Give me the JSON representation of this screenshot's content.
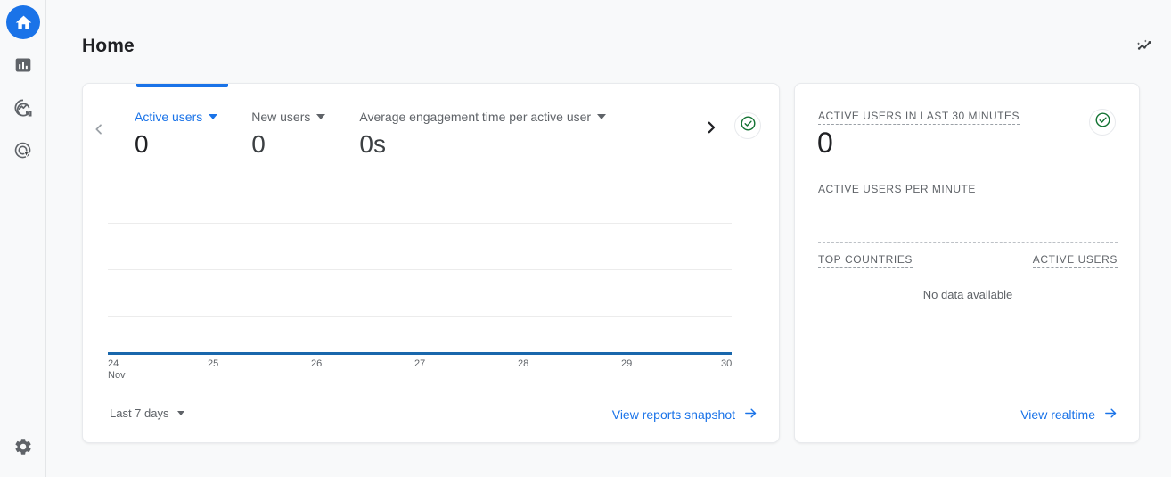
{
  "sidebar": {
    "items": [
      {
        "name": "home",
        "icon": "home-icon",
        "label": "Home",
        "active": true
      },
      {
        "name": "reports",
        "icon": "bar-chart-icon",
        "label": "Reports",
        "active": false
      },
      {
        "name": "explore",
        "icon": "explore-icon",
        "label": "Explore",
        "active": false
      },
      {
        "name": "advertising",
        "icon": "target-icon",
        "label": "Advertising",
        "active": false
      }
    ],
    "settings": {
      "name": "admin",
      "icon": "gear-icon",
      "label": "Admin"
    }
  },
  "header": {
    "title": "Home",
    "action_icon": "insights-sparkline-icon"
  },
  "overview_card": {
    "prev_icon": "chevron-left-icon",
    "next_icon": "chevron-right-icon",
    "status_icon": "check-circle-icon",
    "metrics": [
      {
        "label": "Active users",
        "value": "0",
        "selected": true
      },
      {
        "label": "New users",
        "value": "0",
        "selected": false
      },
      {
        "label": "Average engagement time per active user",
        "value": "0s",
        "selected": false
      }
    ],
    "date_range": "Last 7 days",
    "range_caret_icon": "chevron-down-icon",
    "footer_link": "View reports snapshot",
    "footer_link_icon": "arrow-right-icon"
  },
  "chart_data": {
    "type": "line",
    "title": "Active users",
    "xlabel": "",
    "ylabel": "Active users",
    "categories": [
      "24",
      "25",
      "26",
      "27",
      "28",
      "29",
      "30"
    ],
    "month_label": "Nov",
    "series": [
      {
        "name": "Active users",
        "values": [
          0,
          0,
          0,
          0,
          0,
          0,
          0
        ],
        "color": "#1967ac"
      }
    ],
    "ylim": [
      0,
      1
    ],
    "gridlines": 4,
    "grid": true,
    "legend": "none",
    "zero_baseline_color": "#1967ac"
  },
  "realtime_card": {
    "heading": "ACTIVE USERS IN LAST 30 MINUTES",
    "value": "0",
    "subheading": "ACTIVE USERS PER MINUTE",
    "status_icon": "check-circle-icon",
    "table": {
      "columns": [
        "TOP COUNTRIES",
        "ACTIVE USERS"
      ],
      "rows": [],
      "empty_message": "No data available"
    },
    "footer_link": "View realtime",
    "footer_link_icon": "arrow-right-icon"
  },
  "colors": {
    "accent_blue": "#1a73e8",
    "chart_blue": "#1967ac",
    "status_green": "#137333",
    "page_bg": "#f8f9fa",
    "card_bg": "#ffffff",
    "text_primary": "#202124",
    "text_secondary": "#5f6368"
  }
}
